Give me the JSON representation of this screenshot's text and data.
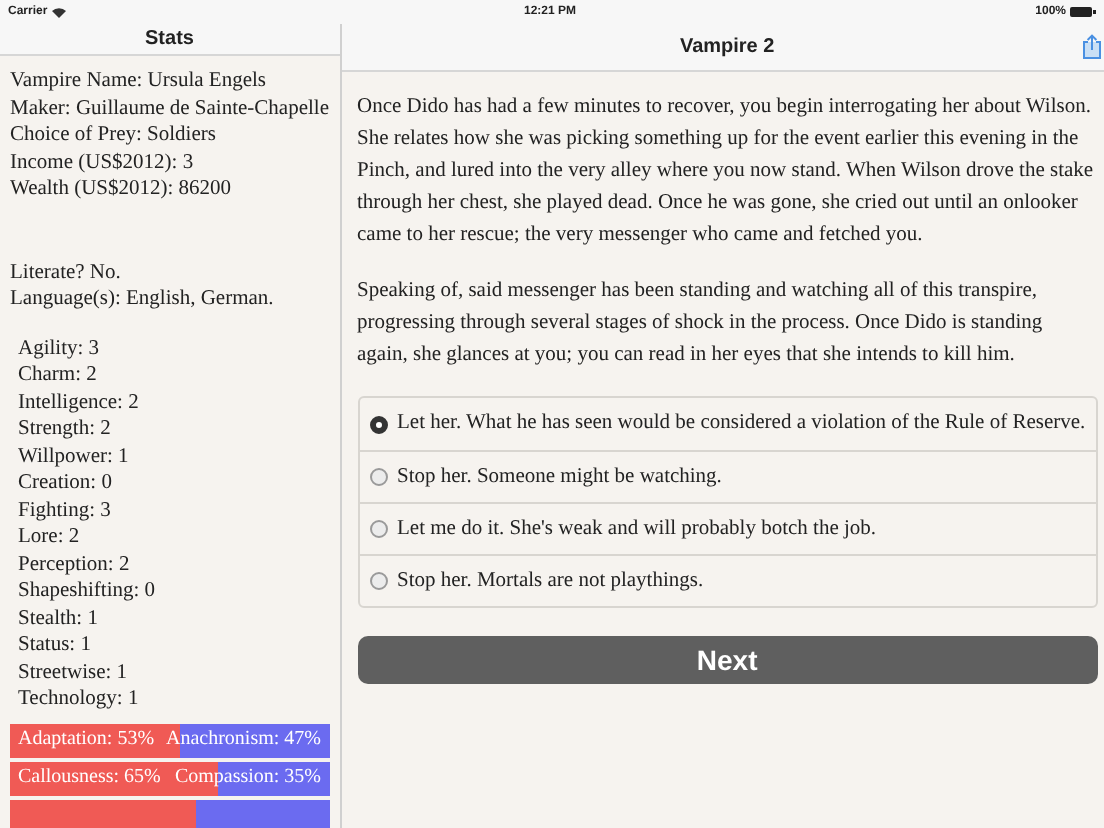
{
  "status_bar": {
    "carrier": "Carrier",
    "time": "12:21 PM",
    "battery": "100%"
  },
  "sidebar": {
    "title": "Stats",
    "info": [
      "Vampire Name: Ursula Engels",
      "Maker: Guillaume de Sainte-Chapelle",
      "Choice of Prey: Soldiers",
      "Income (US$2012): 3",
      "Wealth (US$2012): 86200"
    ],
    "literacy": [
      "Literate? No.",
      "Language(s): English, German."
    ],
    "attributes": [
      "Agility: 3",
      "Charm: 2",
      "Intelligence: 2",
      "Strength: 2",
      "Willpower: 1",
      "Creation: 0",
      "Fighting: 3",
      "Lore: 2",
      "Perception: 2",
      "Shapeshifting: 0",
      "Stealth: 1",
      "Status: 1",
      "Streetwise: 1",
      "Technology: 1"
    ],
    "bars": [
      {
        "left": "Adaptation: 53%",
        "right": "Anachronism: 47%",
        "level": 0.53
      },
      {
        "left": "Callousness: 65%",
        "right": "Compassion: 35%",
        "level": 0.65
      },
      {
        "level": 0.58
      }
    ]
  },
  "main": {
    "title": "Vampire 2",
    "paragraphs": [
      "Once Dido has had a few minutes to recover, you begin interrogating her about Wilson. She relates how she was picking something up for the event earlier this evening in the Pinch, and lured into the very alley where you now stand. When Wilson drove the stake through her chest, she played dead. Once he was gone, she cried out until an onlooker came to her rescue; the very messenger who came and fetched you.",
      "Speaking of, said messenger has been standing and watching all of this transpire, progressing through several stages of shock in the process. Once Dido is standing again, she glances at you; you can read in her eyes that she intends to kill him."
    ],
    "choices": [
      {
        "label": "Let her. What he has seen would be considered a violation of the Rule of Reserve.",
        "selected": true
      },
      {
        "label": "Stop her. Someone might be watching.",
        "selected": false
      },
      {
        "label": "Let me do it. She's weak and will probably botch the job.",
        "selected": false
      },
      {
        "label": "Stop her. Mortals are not playthings.",
        "selected": false
      }
    ],
    "button": "Next"
  }
}
